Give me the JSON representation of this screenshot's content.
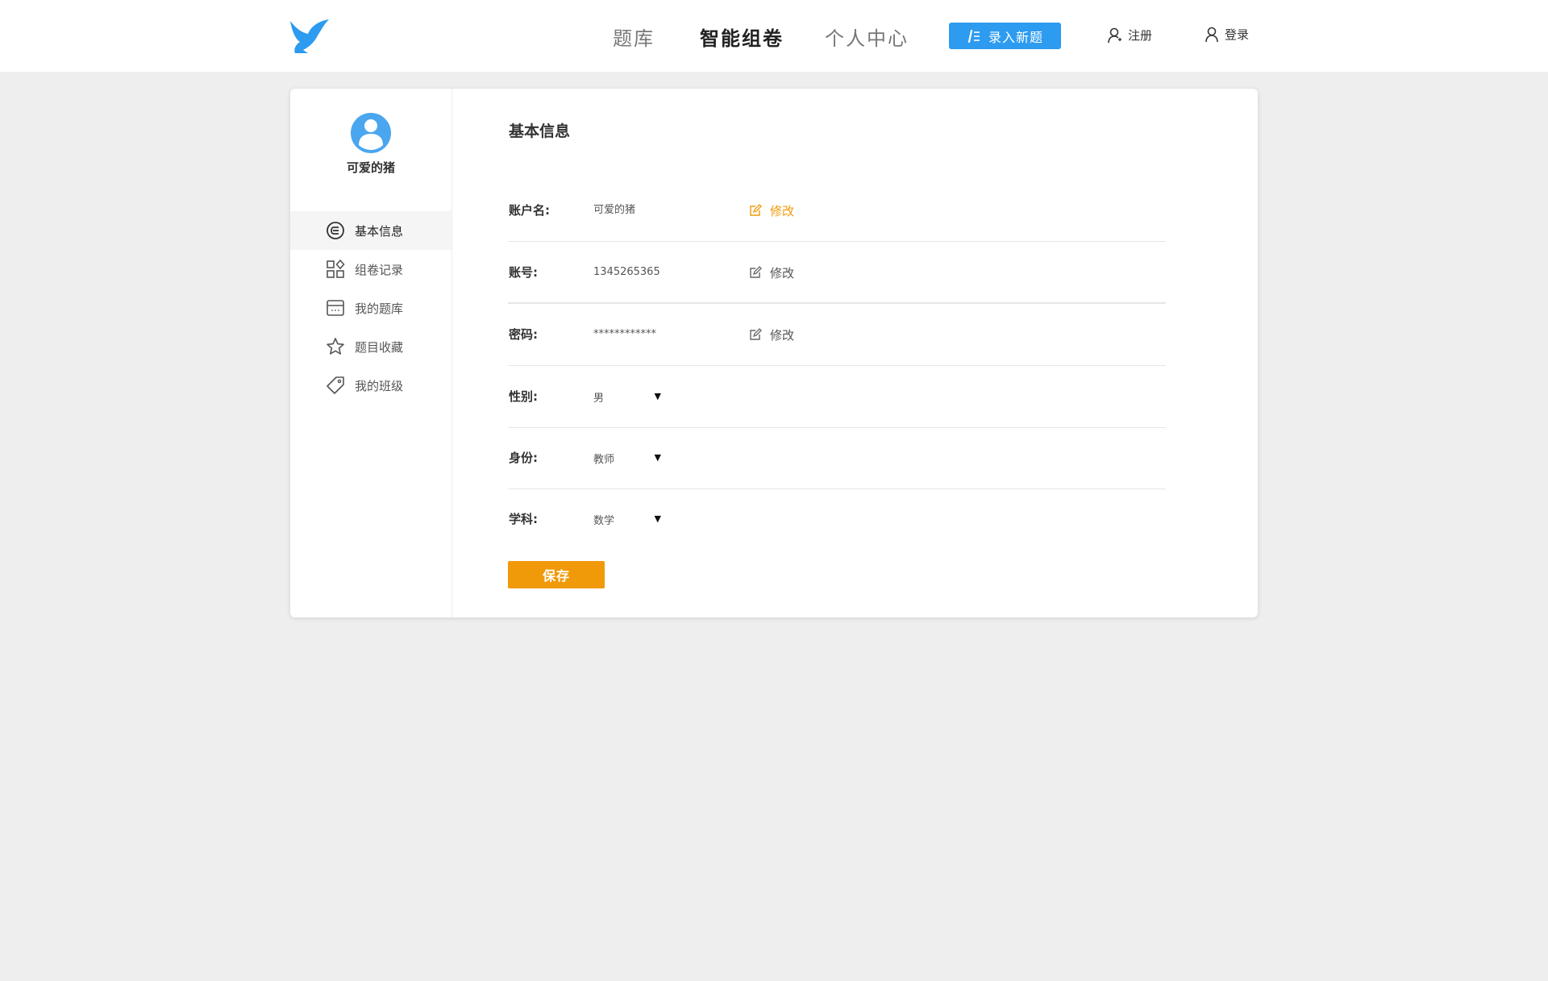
{
  "header": {
    "logo_icon": "bird-logo-icon",
    "nav": [
      {
        "label": "题库",
        "active": false
      },
      {
        "label": "智能组卷",
        "active": true
      },
      {
        "label": "个人中心",
        "active": false
      }
    ],
    "new_question_label": "录入新题",
    "register_label": "注册",
    "login_label": "登录"
  },
  "profile": {
    "username": "可爱的猪",
    "avatar_icon": "user-avatar-icon"
  },
  "sidebar": {
    "items": [
      {
        "label": "基本信息",
        "icon": "info-circle-icon",
        "active": true
      },
      {
        "label": "组卷记录",
        "icon": "apps-icon",
        "active": false
      },
      {
        "label": "我的题库",
        "icon": "calendar-icon",
        "active": false
      },
      {
        "label": "题目收藏",
        "icon": "star-icon",
        "active": false
      },
      {
        "label": "我的班级",
        "icon": "tag-icon",
        "active": false
      }
    ]
  },
  "main": {
    "title": "基本信息",
    "fields": {
      "account_name": {
        "label": "账户名:",
        "value": "可爱的猪",
        "edit": "修改"
      },
      "account": {
        "label": "账号:",
        "value": "1345265365",
        "edit": "修改"
      },
      "password": {
        "label": "密码:",
        "value": "************",
        "edit": "修改"
      },
      "gender": {
        "label": "性别:",
        "value": "男"
      },
      "role": {
        "label": "身份:",
        "value": "教师"
      },
      "subject": {
        "label": "学科:",
        "value": "数学"
      }
    },
    "save_label": "保存"
  },
  "colors": {
    "accent_orange": "#f09a0a",
    "primary_blue": "#2d9bf0",
    "background": "#eeeeee"
  }
}
